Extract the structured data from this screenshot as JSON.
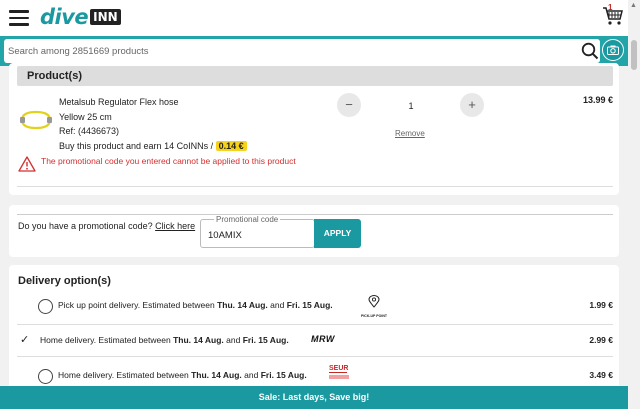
{
  "header": {
    "logo_dive": "dive",
    "logo_inn": "INN",
    "cart_count": "1"
  },
  "search": {
    "placeholder": "Search among 2851669 products"
  },
  "product_section": {
    "title": "Product(s)",
    "name": "Metalsub Regulator Flex hose",
    "variant": "Yellow 25 cm",
    "ref": "Ref: (4436673)",
    "coins_text": "Buy this product and earn 14 CoINNs /",
    "coins_value": "0.14 €",
    "quantity": "1",
    "remove_label": "Remove",
    "price": "13.99 €",
    "warning": "The promotional code you entered cannot be applied to this product"
  },
  "promo": {
    "question": "Do you have a promotional code?",
    "click_here": "Click here",
    "field_label": "Promotional code",
    "value": "10AMIX",
    "apply_label": "APPLY"
  },
  "delivery": {
    "title": "Delivery option(s)",
    "options": [
      {
        "label": "Pick up point delivery. Estimated between",
        "date1": "Thu. 14 Aug.",
        "and": "and",
        "date2": "Fri. 15 Aug.",
        "carrier_logo": "PICK-UP POINT",
        "price": "1.99 €",
        "selected": false
      },
      {
        "label": "Home delivery. Estimated between",
        "date1": "Thu. 14 Aug.",
        "and": "and",
        "date2": "Fri. 15 Aug.",
        "carrier_logo": "MRW",
        "price": "2.99 €",
        "selected": true
      },
      {
        "label": "Home delivery. Estimated between",
        "date1": "Thu. 14 Aug.",
        "and": "and",
        "date2": "Fri. 15 Aug.",
        "carrier_logo": "SEUR",
        "price": "3.49 €",
        "selected": false
      }
    ]
  },
  "banner": {
    "text": "Sale: Last days, Save big!"
  },
  "colors": {
    "accent": "#1a9aa0",
    "warning": "#d32f2f",
    "coin_badge": "#f7d21b"
  },
  "icons": [
    "menu-icon",
    "cart-icon",
    "search-icon",
    "camera-icon",
    "warning-icon",
    "pickup-point-icon",
    "checkmark-icon"
  ]
}
